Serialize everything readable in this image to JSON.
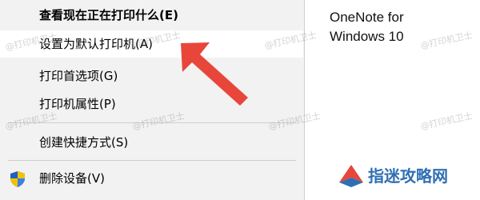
{
  "context_menu": {
    "items": [
      {
        "label": "查看现在正在打印什么(E)"
      },
      {
        "label": "设置为默认打印机(A)"
      },
      {
        "label": "打印首选项(G)"
      },
      {
        "label": "打印机属性(P)"
      },
      {
        "label": "创建快捷方式(S)"
      },
      {
        "label": "删除设备(V)",
        "icon": "shield-icon"
      }
    ]
  },
  "side_panel": {
    "label_line1": "OneNote for",
    "label_line2": "Windows 10"
  },
  "watermark_text": "@打印机卫士",
  "brand": {
    "name": "指迷攻略网",
    "color": "#2f6fb3"
  },
  "colors": {
    "menu_background": "#f2f2f2",
    "hover_background": "#ffffff",
    "arrow": "#e8463a"
  }
}
